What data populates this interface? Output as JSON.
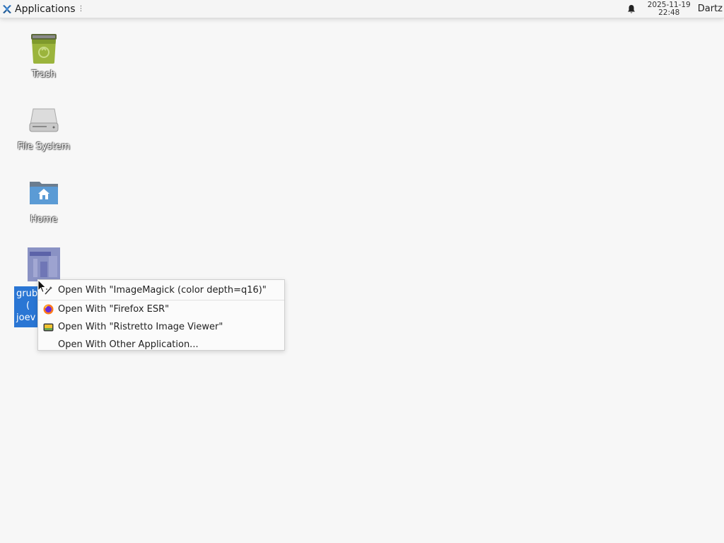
{
  "panel": {
    "apps_label": "Applications",
    "clock_date": "2025-11-19",
    "clock_time": "22:48",
    "user": "Dartz"
  },
  "desktop": {
    "icons": [
      {
        "label": "Trash",
        "icon": "trash-icon"
      },
      {
        "label": "File System",
        "icon": "drive-icon"
      },
      {
        "label": "Home",
        "icon": "home-folder-icon"
      }
    ],
    "selected_file": {
      "label_lines": [
        "grub",
        "(",
        "joev"
      ],
      "icon": "image-thumbnail-icon"
    }
  },
  "context_menu": {
    "items": [
      {
        "label": "Open With \"ImageMagick (color depth=q16)\"",
        "icon": "imagemagick-icon"
      },
      {
        "label": "Open With \"Firefox ESR\"",
        "icon": "firefox-icon"
      },
      {
        "label": "Open With \"Ristretto Image Viewer\"",
        "icon": "ristretto-icon"
      },
      {
        "label": "Open With Other Application...",
        "icon": ""
      }
    ]
  },
  "colors": {
    "selection": "#2a76d4",
    "desktop_bg": "#f7f7f7"
  }
}
